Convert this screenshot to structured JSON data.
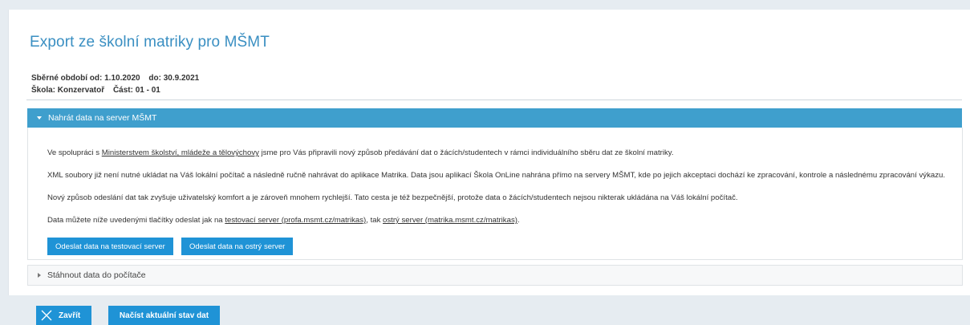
{
  "page": {
    "title": "Export ze školní matriky pro MŠMT"
  },
  "info": {
    "period_label": "Sběrné období od:",
    "period_from": "1.10.2020",
    "period_to_label": "do:",
    "period_to": "30.9.2021",
    "school_label": "Škola:",
    "school_value": "Konzervatoř",
    "part_label": "Část:",
    "part_value": "01 - 01"
  },
  "accordion_upload": {
    "title": "Nahrát data na server MŠMT",
    "expanded": true,
    "p1_before": "Ve spolupráci s ",
    "p1_link": "Ministerstvem školství, mládeže a tělovýchovy",
    "p1_after": " jsme pro Vás připravili nový způsob předávání dat o žácích/studentech v rámci individuálního sběru dat ze školní matriky.",
    "p2": "XML soubory již není nutné ukládat na Váš lokální počítač a následně ručně nahrávat do aplikace Matrika. Data jsou aplikací Škola OnLine nahrána přímo na servery MŠMT, kde po jejich akceptaci dochází ke zpracování, kontrole a následnému zpracování výkazu.",
    "p3": "Nový způsob odeslání dat tak zvyšuje uživatelský komfort a je zároveň mnohem rychlejší. Tato cesta je též bezpečnější, protože data o žácích/studentech nejsou nikterak ukládána na Váš lokální počítač.",
    "p4_before": "Data můžete níže uvedenými tlačítky odeslat jak na ",
    "p4_link1": "testovací server (profa.msmt.cz/matrikas)",
    "p4_middle": ", tak ",
    "p4_link2": "ostrý server (matrika.msmt.cz/matrikas)",
    "p4_after": ".",
    "btn_test": "Odeslat data na testovací server",
    "btn_prod": "Odeslat data na ostrý server"
  },
  "accordion_download": {
    "title": "Stáhnout data do počítače",
    "expanded": false
  },
  "footer": {
    "close_label": "Zavřít",
    "load_label": "Načíst aktuální stav dat"
  },
  "colors": {
    "accent": "#3f9fcd",
    "button": "#1f93d6",
    "title": "#3a8fc2"
  }
}
